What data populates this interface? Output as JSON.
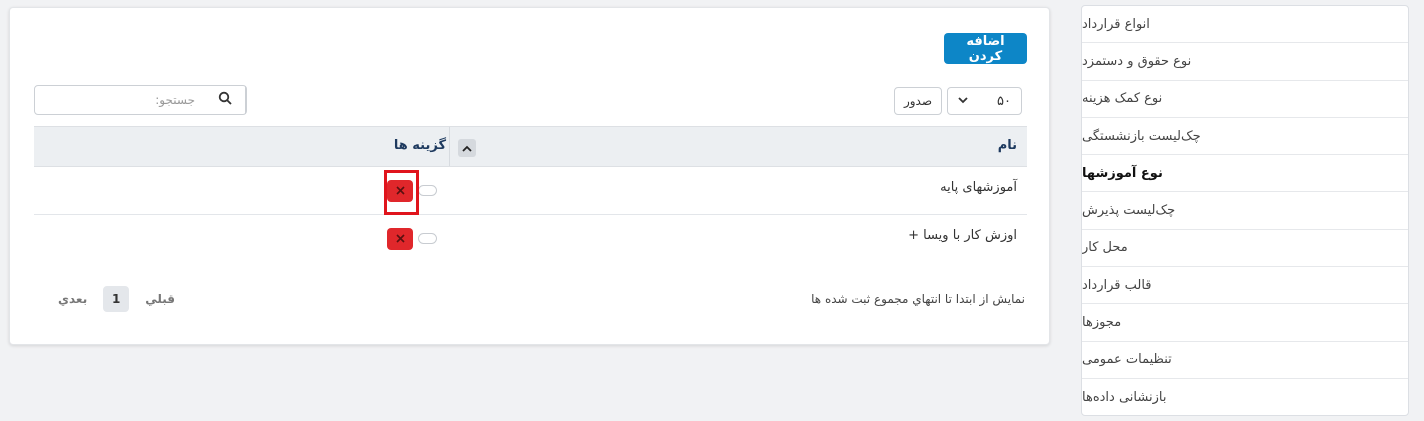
{
  "sidebar": {
    "items": [
      {
        "label": "انواع قرارداد"
      },
      {
        "label": "نوع حقوق و دستمزد"
      },
      {
        "label": "نوع کمک هزینه"
      },
      {
        "label": "چک‌لیست بازنشستگی"
      },
      {
        "label": "نوع آموزشها"
      },
      {
        "label": "چک‌لیست پذیرش"
      },
      {
        "label": "محل کار"
      },
      {
        "label": "قالب قرارداد"
      },
      {
        "label": "مجوزها"
      },
      {
        "label": "تنظیمات عمومی"
      },
      {
        "label": "بازنشانی داده‌ها"
      }
    ],
    "active_index": 4
  },
  "toolbar": {
    "add_label": "اضافه کردن",
    "per_page_value": "۵۰",
    "export_label": "صدور",
    "search_placeholder": "جستجو:"
  },
  "table": {
    "columns": {
      "name": "نام",
      "options": "گزینه ها"
    },
    "rows": [
      {
        "name": "آموزشهای پایه"
      },
      {
        "name": "اوزش کار با ویسا +"
      }
    ]
  },
  "footer": {
    "info": "نمایش از ابتدا تا انتهاي مجموع ثبت شده ها",
    "prev_label": "قبلي",
    "page": "1",
    "next_label": "بعدي"
  },
  "colors": {
    "accent": "#0d86c7",
    "danger": "#e0272b",
    "highlight": "#e0141c"
  },
  "icons": {
    "search": "search-icon",
    "delete": "close-icon",
    "sort": "chevron-up-icon",
    "dropdown": "chevron-down-icon"
  }
}
